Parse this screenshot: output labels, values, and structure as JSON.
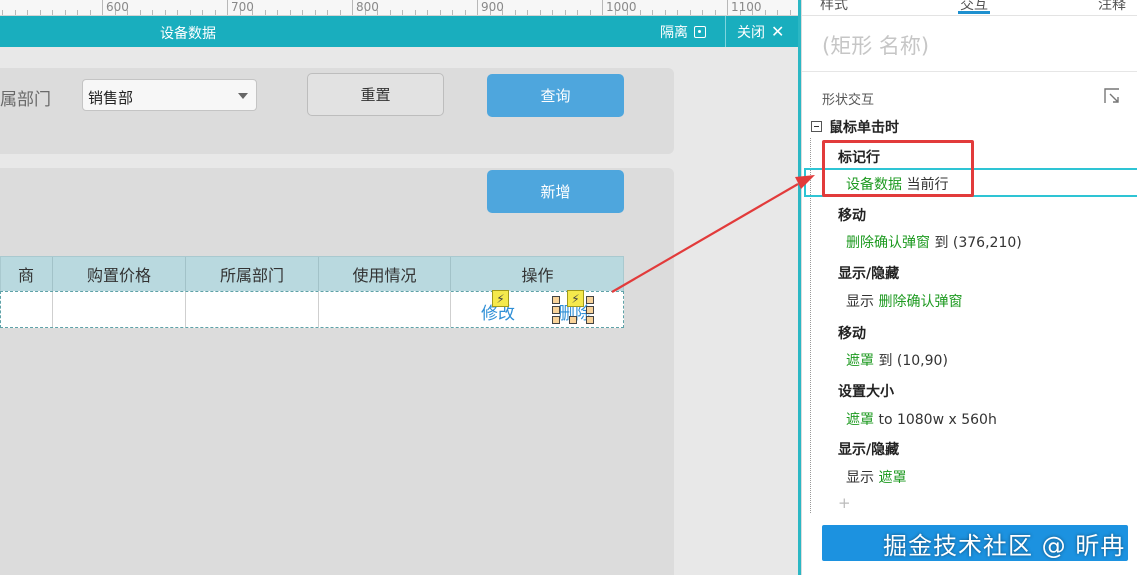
{
  "ruler": {
    "labels": [
      "600",
      "700",
      "800",
      "900",
      "1000",
      "1100"
    ]
  },
  "window": {
    "title": "设备数据",
    "isolate_label": "隔离",
    "close_label": "关闭"
  },
  "filter": {
    "dept_label": "所属部门",
    "dept_selected": "销售部",
    "reset_label": "重置",
    "query_label": "查询"
  },
  "list": {
    "add_label": "新增",
    "columns": [
      "商",
      "购置价格",
      "所属部门",
      "使用情况",
      "操作"
    ],
    "row": {
      "edit_label": "修改",
      "delete_label": "删除"
    }
  },
  "right_panel": {
    "tabs": [
      "样式",
      "交互",
      "注释"
    ],
    "shape_name_placeholder": "(矩形 名称)",
    "section_label": "形状交互",
    "event_title": "鼠标单击时",
    "actions": [
      {
        "title": "标记行",
        "target": "设备数据",
        "rest": " 当前行"
      },
      {
        "title": "移动",
        "target": "删除确认弹窗",
        "rest": " 到 (376,210)"
      },
      {
        "title": "显示/隐藏",
        "prefix": "显示 ",
        "target": "删除确认弹窗"
      },
      {
        "title": "移动",
        "target": "遮罩",
        "rest": " 到 (10,90)"
      },
      {
        "title": "设置大小",
        "target": "遮罩",
        "rest": " to 1080w x 560h"
      },
      {
        "title": "显示/隐藏",
        "prefix": "显示 ",
        "target": "遮罩"
      }
    ],
    "add_symbol": "+",
    "watermark": "掘金技术社区 @ 昕冉"
  },
  "colors": {
    "title_bar": "#19aebe",
    "primary_button": "#4ea6dd",
    "highlight_red": "#e23b3b",
    "highlight_cyan": "#2ec4d4",
    "target_green": "#1d9a20"
  }
}
